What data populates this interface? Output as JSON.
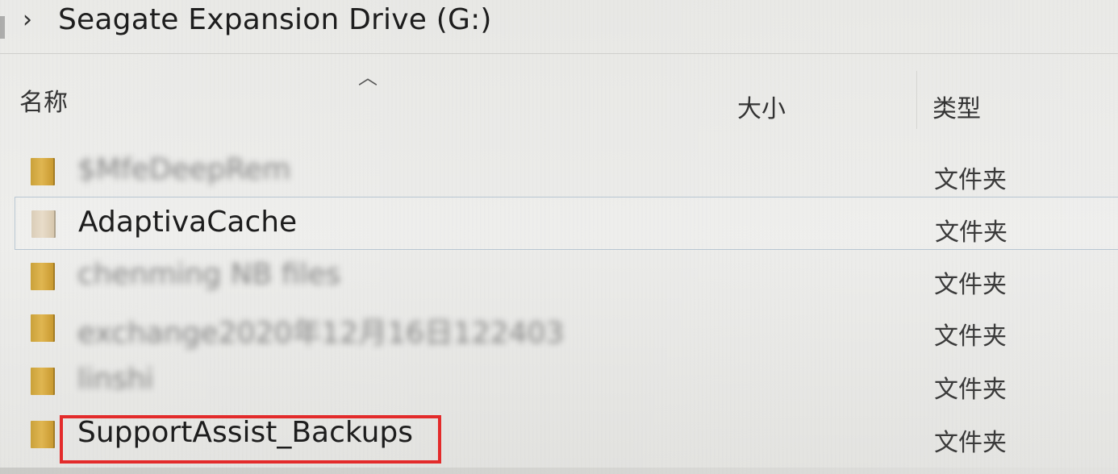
{
  "address_bar": {
    "separator_icon": "chevron-right-icon",
    "location": "Seagate Expansion Drive (G:)"
  },
  "columns": {
    "name": "名称",
    "size": "大小",
    "type": "类型",
    "sort_icon": "sort-ascending-icon"
  },
  "files": [
    {
      "name": "$MfeDeepRem",
      "type": "文件夹",
      "blurred": true
    },
    {
      "name": "AdaptivaCache",
      "type": "文件夹",
      "blurred": false,
      "selected": true
    },
    {
      "name": "chenming NB files",
      "type": "文件夹",
      "blurred": true
    },
    {
      "name": "exchange2020年12月16日122403",
      "type": "文件夹",
      "blurred": true
    },
    {
      "name": "linshi",
      "type": "文件夹",
      "blurred": true
    },
    {
      "name": "SupportAssist_Backups",
      "type": "文件夹",
      "blurred": false,
      "highlighted": true
    }
  ],
  "colors": {
    "highlight_border": "#e32b2b",
    "folder": "#d8ae47",
    "selection_border": "#b8c6d2"
  }
}
